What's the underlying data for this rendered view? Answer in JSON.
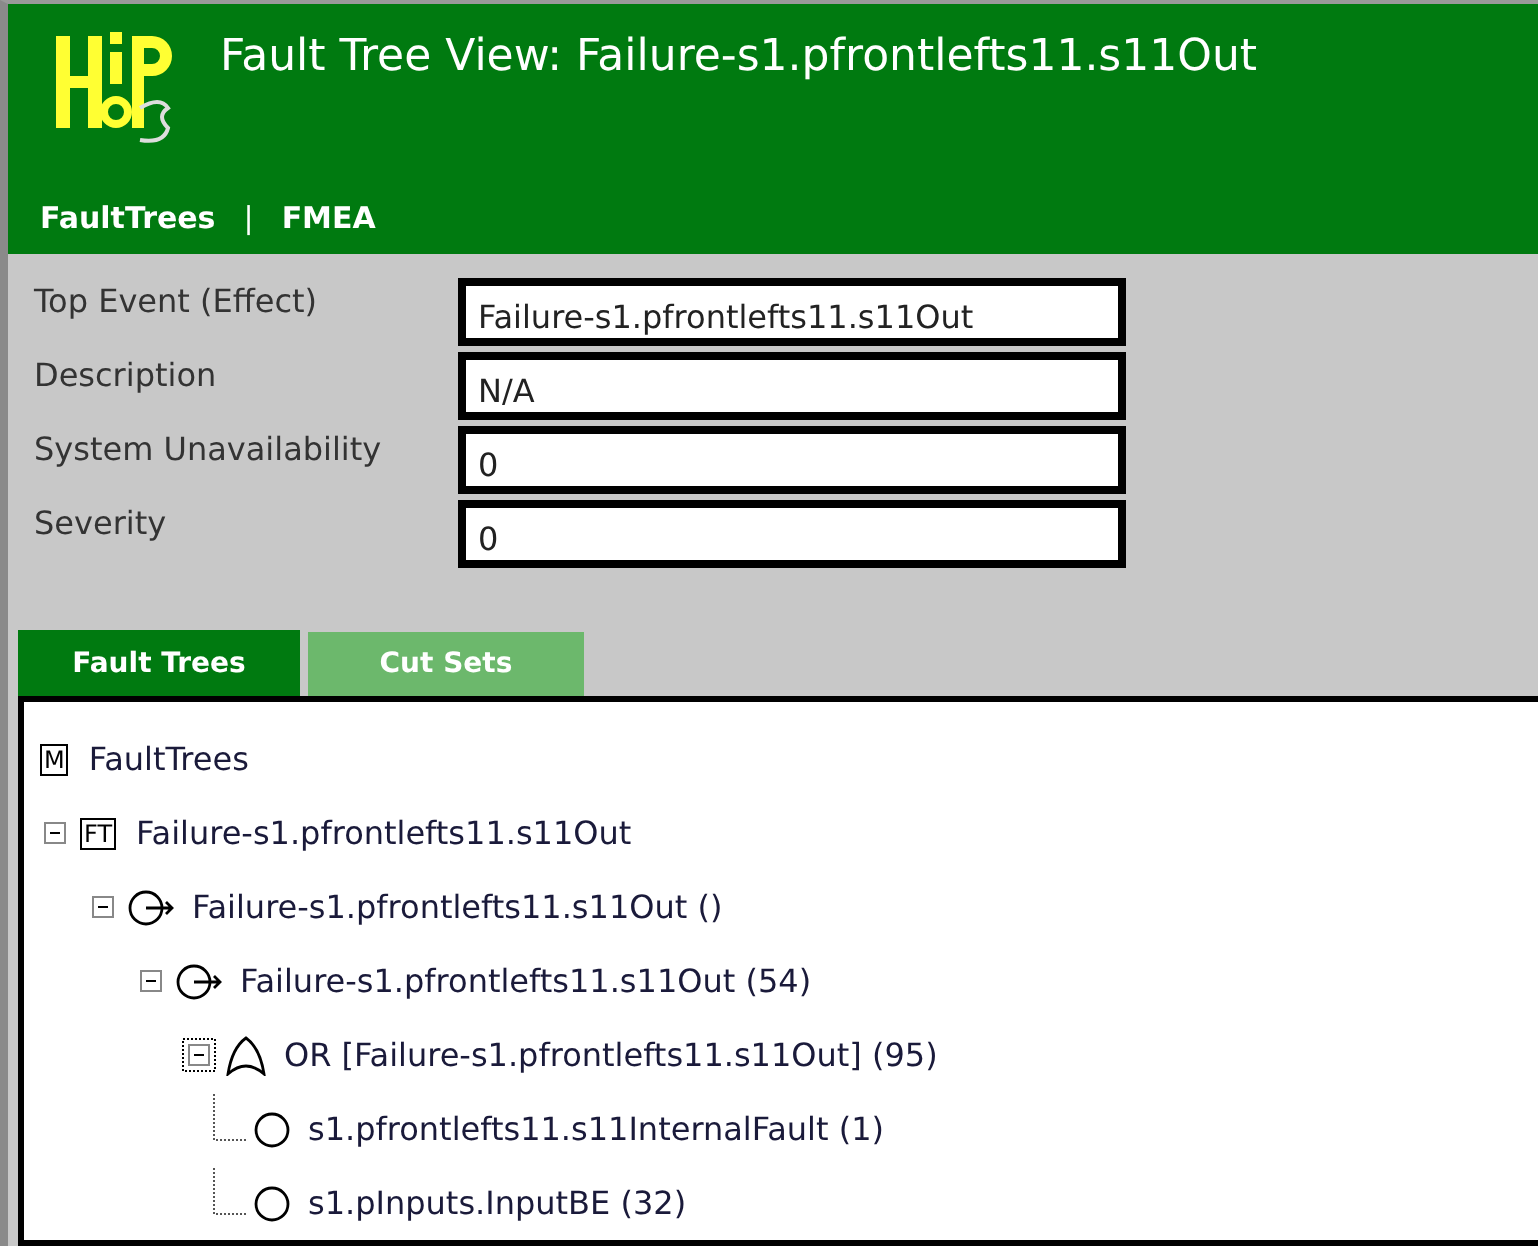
{
  "header": {
    "title": "Fault Tree View: Failure-s1.pfrontlefts11.s11Out",
    "nav": [
      "FaultTrees",
      "FMEA"
    ],
    "separator": "|"
  },
  "fields": [
    {
      "label": "Top Event (Effect)",
      "value": "Failure-s1.pfrontlefts11.s11Out"
    },
    {
      "label": "Description",
      "value": "N/A"
    },
    {
      "label": "System Unavailability",
      "value": "0"
    },
    {
      "label": "Severity",
      "value": "0"
    }
  ],
  "tabs": [
    {
      "label": "Fault Trees",
      "selected": true
    },
    {
      "label": "Cut Sets",
      "selected": false
    }
  ],
  "tree": {
    "kind": "root",
    "badge": "M",
    "label": "FaultTrees",
    "children": [
      {
        "kind": "tree",
        "badge": "FT",
        "label": "Failure-s1.pfrontlefts11.s11Out",
        "expanded": true,
        "selected": false,
        "children": [
          {
            "kind": "event",
            "label": "Failure-s1.pfrontlefts11.s11Out ()",
            "expanded": true,
            "selected": false,
            "children": [
              {
                "kind": "event",
                "label": "Failure-s1.pfrontlefts11.s11Out (54)",
                "expanded": true,
                "selected": false,
                "children": [
                  {
                    "kind": "gate",
                    "label": "OR [Failure-s1.pfrontlefts11.s11Out] (95)",
                    "expanded": true,
                    "selected": true,
                    "children": [
                      {
                        "kind": "basic",
                        "label": "s1.pfrontlefts11.s11InternalFault (1)"
                      },
                      {
                        "kind": "basic",
                        "label": "s1.pInputs.InputBE (32)"
                      }
                    ]
                  }
                ]
              }
            ]
          }
        ]
      }
    ]
  }
}
